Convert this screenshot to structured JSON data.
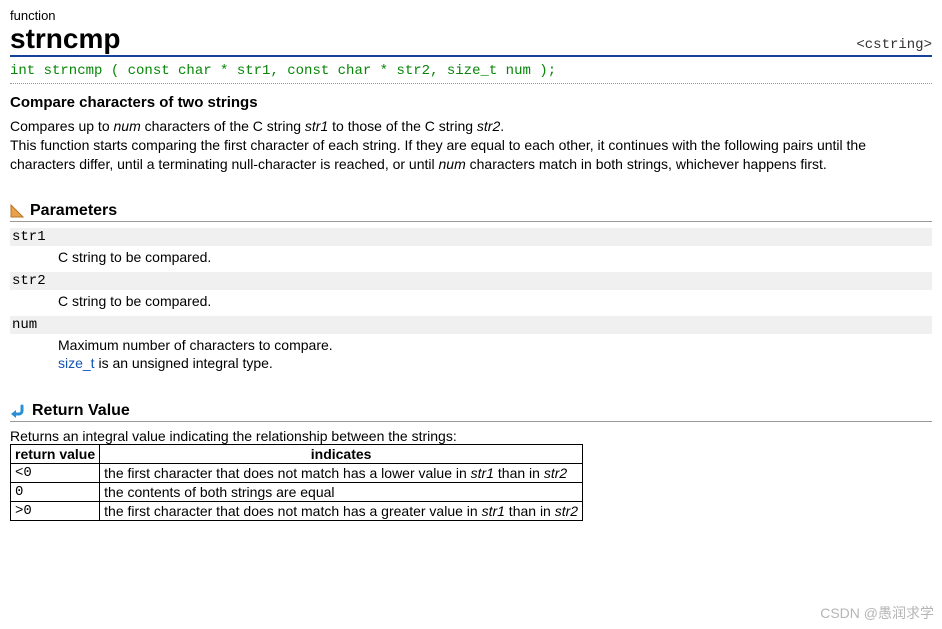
{
  "top_label": "function",
  "fn_name": "strncmp",
  "header_tag": "<cstring>",
  "signature": "int strncmp ( const char * str1, const char * str2, size_t num );",
  "brief": "Compare characters of two strings",
  "desc": {
    "p1_a": "Compares up to ",
    "p1_num": "num",
    "p1_b": " characters of the C string ",
    "p1_str1": "str1",
    "p1_c": " to those of the C string ",
    "p1_str2": "str2",
    "p1_d": ".",
    "p2_a": "This function starts comparing the first character of each string. If they are equal to each other, it continues with the following pairs until the characters differ, until a terminating null-character is reached, or until ",
    "p2_num": "num",
    "p2_b": " characters match in both strings, whichever happens first."
  },
  "sections": {
    "parameters": "Parameters",
    "return_value": "Return Value"
  },
  "params": {
    "str1": {
      "name": "str1",
      "desc": "C string to be compared."
    },
    "str2": {
      "name": "str2",
      "desc": "C string to be compared."
    },
    "num": {
      "name": "num",
      "desc_a": "Maximum number of characters to compare.",
      "desc_b1": "size_t",
      "desc_b2": " is an unsigned integral type."
    }
  },
  "return": {
    "intro": "Returns an integral value indicating the relationship between the strings:",
    "th_value": "return value",
    "th_indicates": "indicates",
    "rows": [
      {
        "val": "<0",
        "txt_a": "the first character that does not match has a lower value in ",
        "em1": "str1",
        "txt_b": " than in ",
        "em2": "str2"
      },
      {
        "val": "0",
        "txt_a": "the contents of both strings are equal",
        "em1": "",
        "txt_b": "",
        "em2": ""
      },
      {
        "val": ">0",
        "txt_a": "the first character that does not match has a greater value in ",
        "em1": "str1",
        "txt_b": " than in ",
        "em2": "str2"
      }
    ]
  },
  "watermark": "CSDN @愚润求学"
}
